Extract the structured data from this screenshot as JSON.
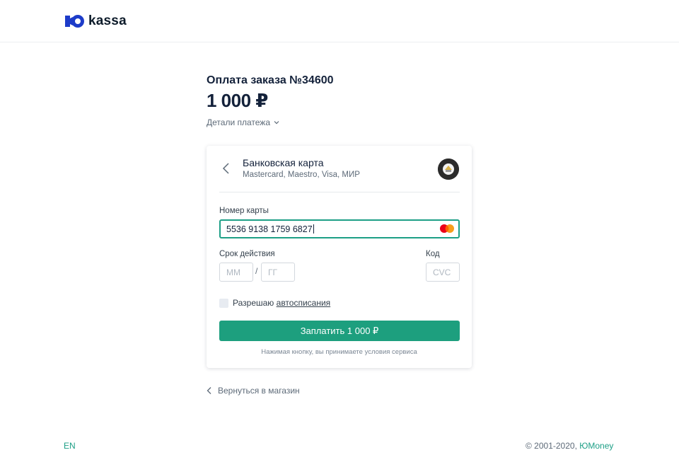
{
  "brand": {
    "logo_text": "kassa",
    "accent": "#1d9f86",
    "button_color": "#1d9f7e"
  },
  "order": {
    "title": "Оплата заказа №34600",
    "amount": "1 000 ₽",
    "details_label": "Детали платежа",
    "details_icon": "chevron-down-icon"
  },
  "payment_method": {
    "back_icon": "chevron-left-icon",
    "title": "Банковская карта",
    "subtitle": "Mastercard, Maestro, Visa, МИР",
    "bank_icon": "bank-badge-icon"
  },
  "form": {
    "card_number_label": "Номер карты",
    "card_number_value": "5536 9138 1759 6827",
    "card_brand_icon": "mastercard-icon",
    "expiry_label": "Срок действия",
    "month_placeholder": "ММ",
    "separator": "/",
    "year_placeholder": "ГГ",
    "cvc_label": "Код",
    "cvc_placeholder": "CVC",
    "autopay_label": "Разрешаю",
    "autopay_link": "автосписания",
    "pay_button": "Заплатить 1 000 ₽",
    "terms": "Нажимая кнопку, вы принимаете условия сервиса"
  },
  "footer": {
    "return_label": "Вернуться в магазин",
    "language": "EN",
    "copyright": "© 2001-2020,",
    "copyright_brand": "ЮMoney"
  }
}
